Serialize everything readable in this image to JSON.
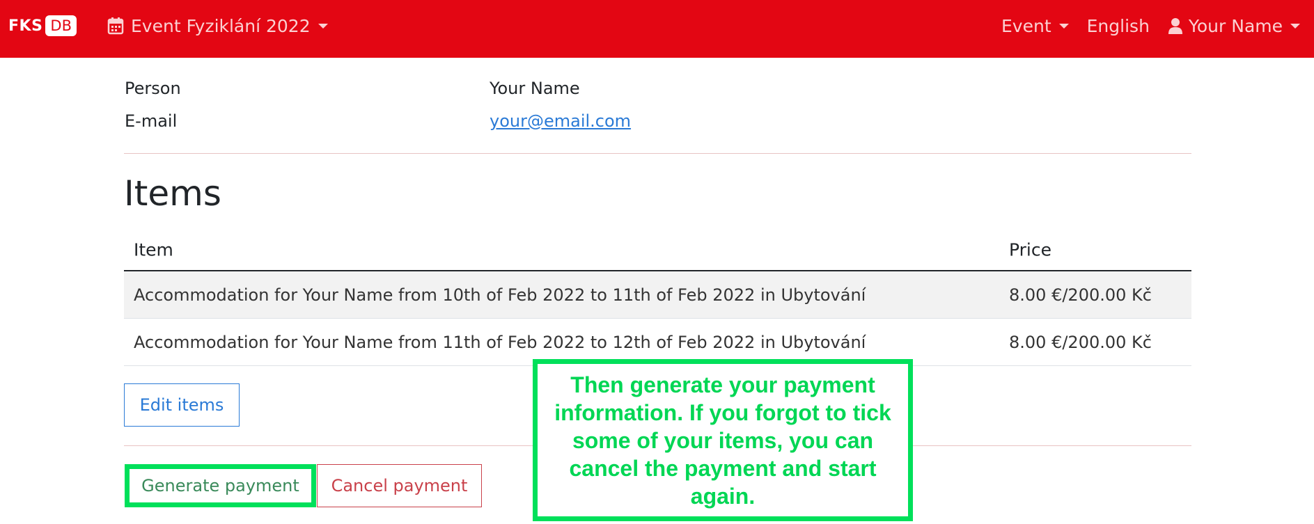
{
  "navbar": {
    "brand_left": "FKS",
    "brand_right": "DB",
    "event_selector": "Event Fyziklání 2022",
    "event_menu": "Event",
    "language": "English",
    "user": "Your Name"
  },
  "person": {
    "label_person": "Person",
    "value_person": "Your Name",
    "label_email": "E-mail",
    "value_email": "your@email.com"
  },
  "items": {
    "heading": "Items",
    "columns": [
      "Item",
      "Price"
    ],
    "rows": [
      {
        "item": "Accommodation for Your Name from 10th of Feb 2022 to 11th of Feb 2022 in Ubytování",
        "price": "8.00 €/200.00 Kč"
      },
      {
        "item": "Accommodation for Your Name from 11th of Feb 2022 to 12th of Feb 2022 in Ubytování",
        "price": "8.00 €/200.00 Kč"
      }
    ],
    "edit_label": "Edit items"
  },
  "payment": {
    "generate_label": "Generate payment",
    "cancel_label": "Cancel payment"
  },
  "callout": {
    "text": "Then generate your payment information. If you forgot to tick some of your items, you can cancel the payment and start again."
  },
  "colors": {
    "navbar": "#e30613",
    "link": "#2a7ad6",
    "highlight": "#00e05a",
    "danger": "#c9414a",
    "success": "#3a8a5a"
  },
  "icons": {
    "event_selector": "calendar-icon",
    "user": "user-icon"
  }
}
